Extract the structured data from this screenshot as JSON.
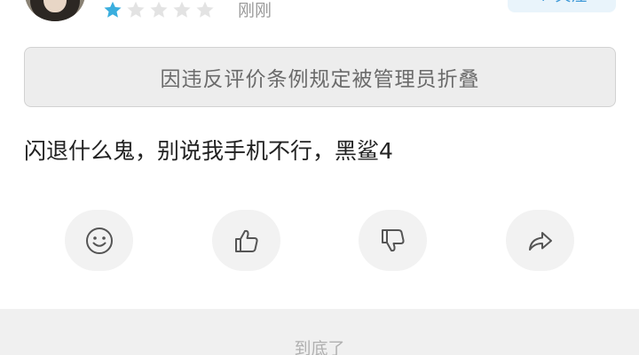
{
  "review": {
    "rating": 1,
    "rating_max": 5,
    "time": "刚刚",
    "follow_label": "+ 关注",
    "fold_notice": "因违反评价条例规定被管理员折叠",
    "comment": "闪退什么鬼，别说我手机不行，黑鲨4"
  },
  "actions": [
    {
      "name": "emoji-react-button",
      "icon": "smiley-icon"
    },
    {
      "name": "like-button",
      "icon": "thumbs-up-icon"
    },
    {
      "name": "dislike-button",
      "icon": "thumbs-down-icon"
    },
    {
      "name": "share-button",
      "icon": "share-arrow-icon"
    }
  ],
  "footer": {
    "end_text": "到底了"
  },
  "colors": {
    "star_filled": "#3aaede",
    "star_empty": "#e3e3e3",
    "accent": "#3f9ad8"
  }
}
